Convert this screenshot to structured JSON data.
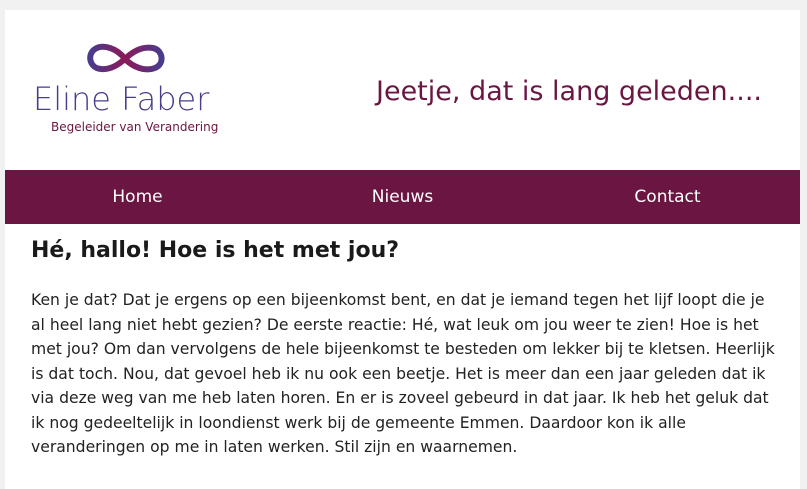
{
  "brand": {
    "name": "Eline Faber",
    "tagline": "Begeleider van Verandering",
    "logo_icon": "infinity-logo",
    "colors": {
      "purple": "#4a3b8c",
      "plum": "#6b1642"
    }
  },
  "header": {
    "title": "Jeetje, dat is lang geleden...."
  },
  "nav": {
    "background": "#6b1642",
    "items": [
      {
        "label": "Home"
      },
      {
        "label": "Nieuws"
      },
      {
        "label": "Contact"
      }
    ]
  },
  "post": {
    "title": "Hé, hallo! Hoe is het met jou?",
    "body": "Ken je dat? Dat je ergens op een bijeenkomst bent, en dat je iemand tegen het lijf loopt die je al heel lang niet hebt gezien? De eerste reactie: Hé, wat leuk om jou weer te zien! Hoe is het met jou? Om dan vervolgens de hele bijeenkomst te besteden om lekker bij te kletsen. Heerlijk is dat toch. Nou, dat gevoel heb ik nu ook een beetje. Het is meer dan een jaar geleden dat ik via deze weg van me heb laten horen. En er is zoveel gebeurd in dat jaar. Ik heb het geluk dat ik nog gedeeltelijk in loondienst werk bij de gemeente Emmen. Daardoor kon ik alle veranderingen op me in laten werken. Stil zijn en waarnemen."
  }
}
